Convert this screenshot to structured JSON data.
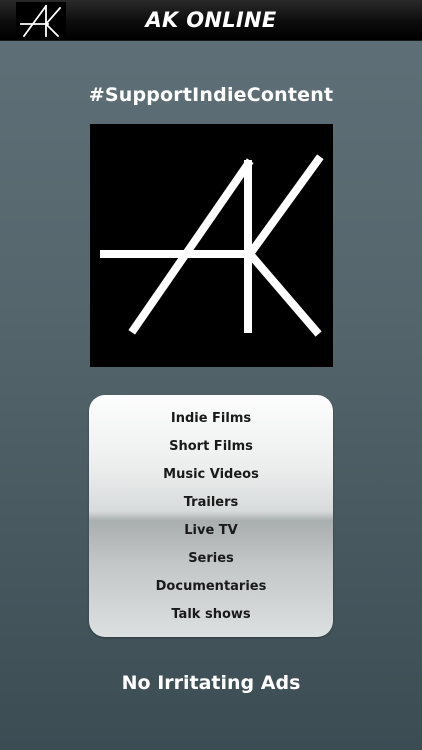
{
  "header": {
    "title": "AK ONLINE",
    "logo_icon": "ak-monogram-icon"
  },
  "hashtag": "#SupportIndieContent",
  "hero_logo_icon": "ak-monogram-icon",
  "categories": [
    {
      "label": "Indie Films"
    },
    {
      "label": "Short Films"
    },
    {
      "label": "Music Videos"
    },
    {
      "label": "Trailers"
    },
    {
      "label": "Live TV"
    },
    {
      "label": "Series"
    },
    {
      "label": "Documentaries"
    },
    {
      "label": "Talk shows"
    }
  ],
  "tagline": "No Irritating Ads",
  "colors": {
    "header_bg": "#000000",
    "page_bg": "#55666d",
    "text": "#ffffff",
    "menu_text": "#1a1a1a"
  }
}
